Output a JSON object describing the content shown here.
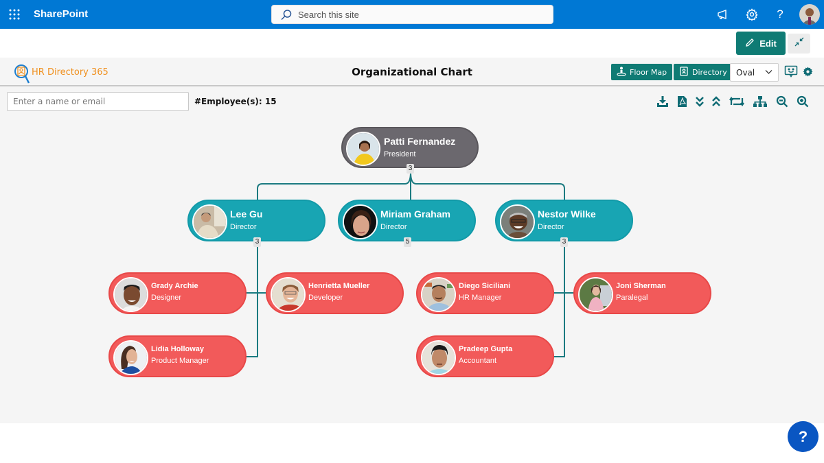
{
  "suitebar": {
    "app_name": "SharePoint",
    "search_placeholder": "Search this site",
    "icons": [
      "waffle-icon",
      "megaphone-icon",
      "gear-icon",
      "help-icon",
      "user-avatar"
    ],
    "color": "#0078d4"
  },
  "commandbar": {
    "edit_label": "Edit",
    "collapse_icon": "collapse-icon"
  },
  "app": {
    "logo_text": "HR Directory 365",
    "title": "Organizational Chart",
    "floor_map_label": "Floor Map",
    "directory_label": "Directory",
    "shape_select": {
      "value": "Oval"
    },
    "search_placeholder": "Enter a name or email",
    "employee_count_label": "#Employee(s): 15",
    "toolbar_icons": [
      "download-icon",
      "pdf-icon",
      "expand-all-icon",
      "collapse-all-icon",
      "swap-layout-icon",
      "hierarchy-icon",
      "zoom-out-icon",
      "zoom-in-icon"
    ],
    "accent_color": "#0f7b74"
  },
  "org": {
    "president": {
      "name": "Patti Fernandez",
      "title": "President",
      "reports": "3"
    },
    "directors": [
      {
        "name": "Lee Gu",
        "title": "Director",
        "reports": "3"
      },
      {
        "name": "Miriam Graham",
        "title": "Director",
        "reports": "5"
      },
      {
        "name": "Nestor Wilke",
        "title": "Director",
        "reports": "3"
      }
    ],
    "employees": [
      {
        "name": "Grady Archie",
        "title": "Designer"
      },
      {
        "name": "Henrietta Mueller",
        "title": "Developer"
      },
      {
        "name": "Lidia Holloway",
        "title": "Product Manager"
      },
      {
        "name": "Diego Siciliani",
        "title": "HR Manager"
      },
      {
        "name": "Joni Sherman",
        "title": "Paralegal"
      },
      {
        "name": "Pradeep Gupta",
        "title": "Accountant"
      }
    ],
    "colors": {
      "president": "#6b686e",
      "director": "#18a5b3",
      "employee": "#f25a5a",
      "connector": "#1a7a80"
    }
  },
  "help_button": {
    "label": "?"
  }
}
